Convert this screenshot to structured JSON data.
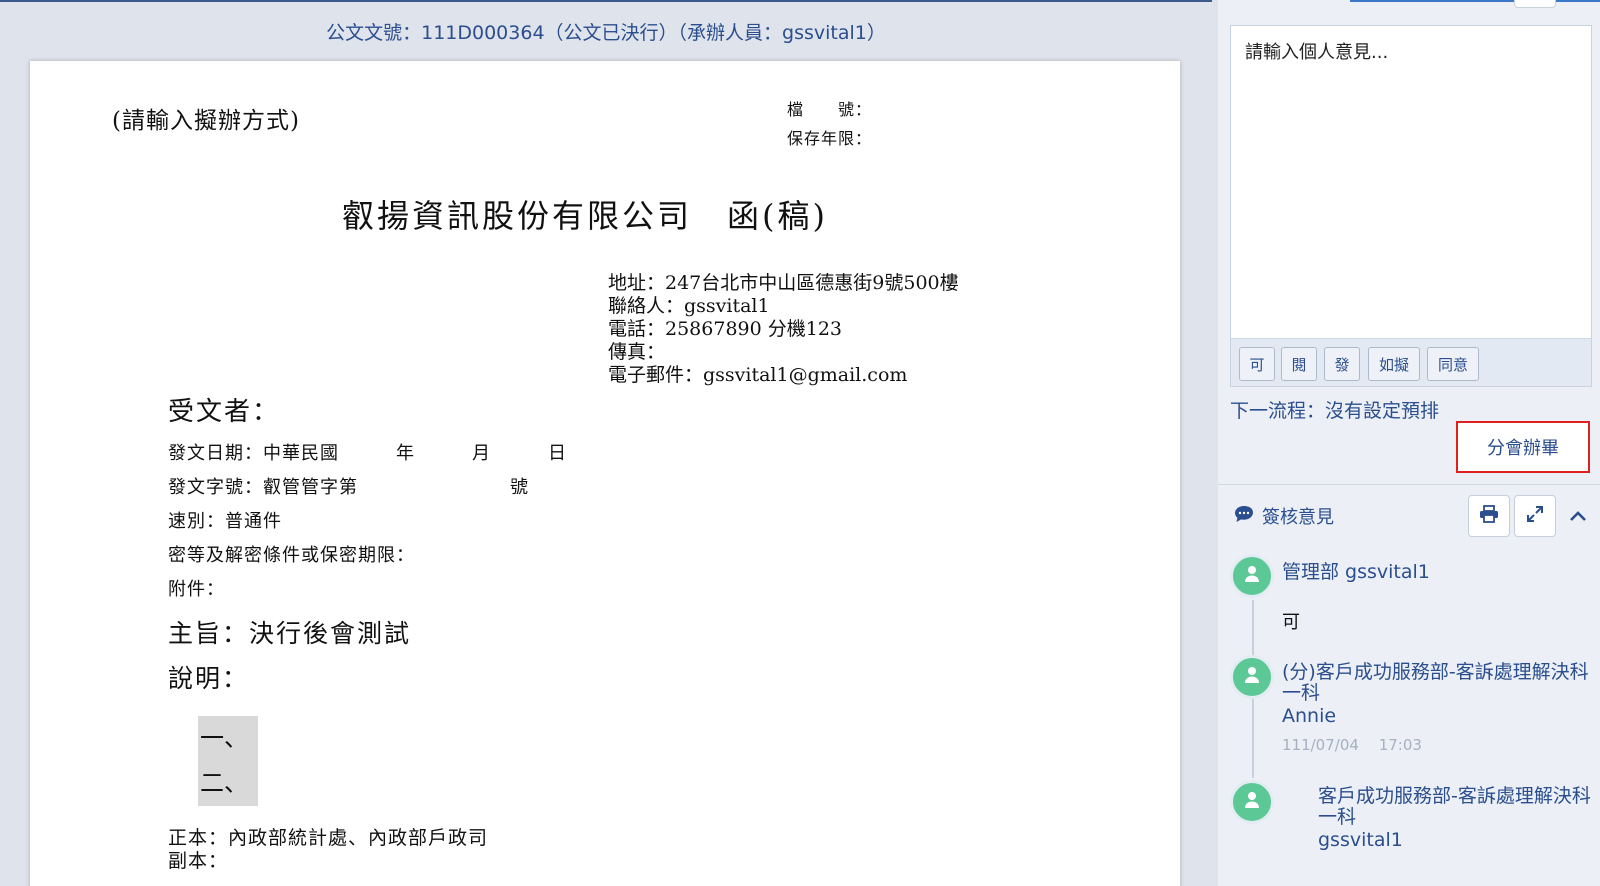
{
  "header": {
    "doc_info": "公文文號：111D000364（公文已決行）（承辦人員：gssvital1）"
  },
  "document": {
    "method_placeholder": "(請輸入擬辦方式)",
    "file_no_label": "檔　　號：",
    "retention_label": "保存年限：",
    "title": "叡揚資訊股份有限公司　函(稿)",
    "sender": {
      "address": "地址：247台北市中山區德惠街9號500樓",
      "contact": "聯絡人：gssvital1",
      "phone": "電話：25867890 分機123",
      "fax": "傳真：",
      "email": "電子郵件：gssvital1@gmail.com"
    },
    "recipient_label": "受文者：",
    "meta": {
      "date": "發文日期：中華民國　　　年　　　月　　　日",
      "doc_number": "發文字號：叡管管字第　　　　　　　　號",
      "speed": "速別：普通件",
      "secrecy": "密等及解密條件或保密期限：",
      "attachment": "附件："
    },
    "subject": "主旨：決行後會測試",
    "explanation_label": "說明：",
    "items": [
      "一、",
      "二、"
    ],
    "original_copy": "正本：內政部統計處、內政部戶政司",
    "carbon_copy": "副本："
  },
  "opinion": {
    "placeholder": "請輸入個人意見...",
    "quick_phrases": [
      "可",
      "閱",
      "發",
      "如擬",
      "同意"
    ],
    "next_flow": "下一流程：沒有設定預排",
    "submit_label": "分會辦畢"
  },
  "sign_review": {
    "title": "簽核意見",
    "icons": [
      "comment-icon",
      "print-icon",
      "expand-icon",
      "chevron-up-icon"
    ],
    "entries": [
      {
        "dept_user": "管理部 gssvital1",
        "comment": "可"
      },
      {
        "dept": "(分)客戶成功服務部-客訴處理解決科 一科",
        "user": "Annie",
        "date": "111/07/04",
        "time": "17:03"
      },
      {
        "dept": "客戶成功服務部-客訴處理解決科 一科",
        "user": "gssvital1"
      }
    ]
  },
  "colors": {
    "accent": "#2b4e8e",
    "highlight_border": "#e02020",
    "avatar": "#5cc896",
    "panel_bg": "#ecf0f6"
  }
}
